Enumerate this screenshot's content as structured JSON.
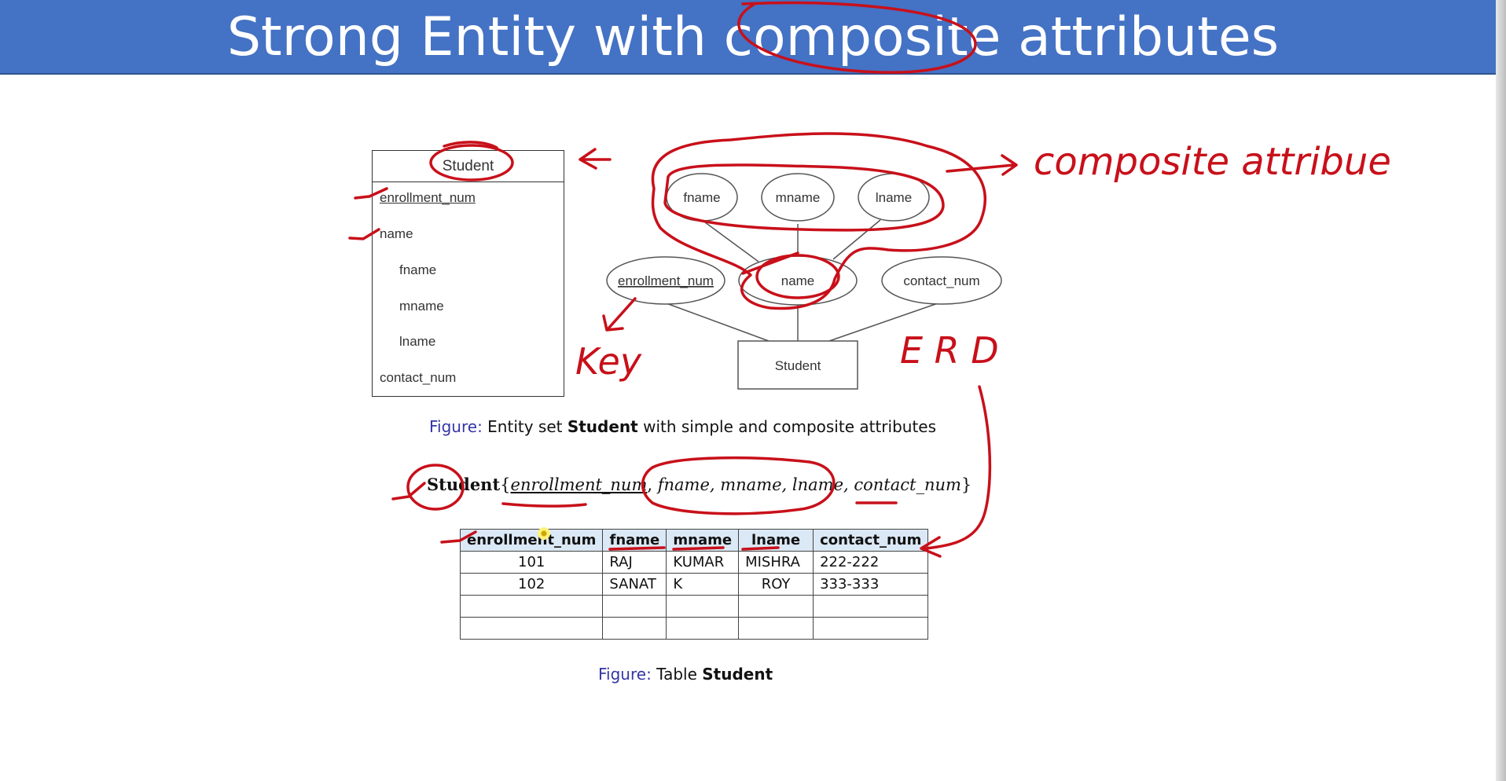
{
  "slide": {
    "title": "Strong Entity with composite attributes"
  },
  "uml_entity": {
    "name": "Student",
    "attributes": [
      {
        "label": "enrollment_num",
        "key": true
      },
      {
        "label": "name"
      },
      {
        "label": "fname"
      },
      {
        "label": "mname"
      },
      {
        "label": "lname"
      },
      {
        "label": "contact_num"
      }
    ]
  },
  "erd": {
    "entity": "Student",
    "attributes": {
      "enrollment": "enrollment_num",
      "name": "name",
      "contact": "contact_num",
      "fname": "fname",
      "mname": "mname",
      "lname": "lname"
    }
  },
  "caption_erd": {
    "label": "Figure:",
    "before": "Entity set",
    "bold": "Student",
    "after": "with simple and composite attributes"
  },
  "schema": {
    "relation": "Student",
    "key": "enrollment_num",
    "composite_parts": "fname, mname, lname,",
    "last": "contact_num"
  },
  "table": {
    "headers": [
      "enrollment_num",
      "fname",
      "mname",
      "lname",
      "contact_num"
    ],
    "rows": [
      [
        "101",
        "RAJ",
        "KUMAR",
        "MISHRA",
        "222-222"
      ],
      [
        "102",
        "SANAT",
        "K",
        "ROY",
        "333-333"
      ],
      [
        "",
        "",
        "",
        "",
        ""
      ],
      [
        "",
        "",
        "",
        "",
        ""
      ]
    ]
  },
  "caption_table": {
    "label": "Figure:",
    "before": "Table",
    "bold": "Student"
  },
  "handwriting": {
    "composite": "composite attribue",
    "key": "Key",
    "erd": "E R D"
  },
  "colors": {
    "title_bar": "#4472c4",
    "annotation_ink": "#c8101a",
    "figure_label": "#3535a8",
    "table_header": "#dbe8f5"
  }
}
